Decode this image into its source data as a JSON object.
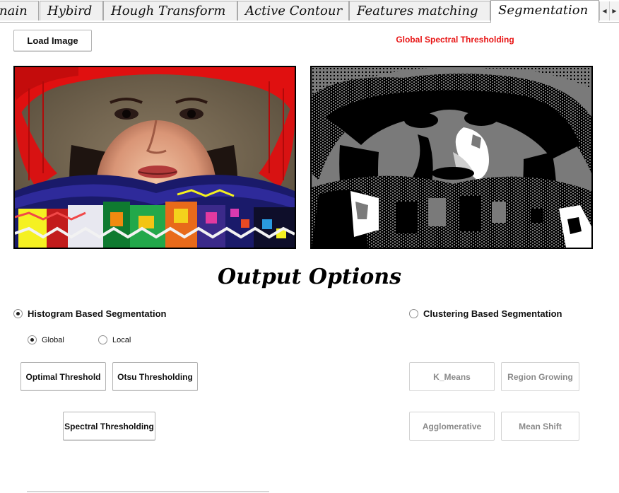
{
  "tabs": [
    {
      "label": "nain"
    },
    {
      "label": "Hybird"
    },
    {
      "label": "Hough Transform"
    },
    {
      "label": "Active Contour"
    },
    {
      "label": "Features matching"
    },
    {
      "label": "Segmentation"
    }
  ],
  "active_tab": "Segmentation",
  "tab_scroll": {
    "left_icon": "chevron-left-icon",
    "right_icon": "chevron-right-icon"
  },
  "toolbar": {
    "load_label": "Load Image"
  },
  "status": {
    "text": "Global Spectral Thresholding",
    "color": "#e81414"
  },
  "images": {
    "input": "input-photo",
    "output": "segmented-output"
  },
  "output_options": {
    "title": "Output Options"
  },
  "histogram": {
    "label": "Histogram Based Segmentation",
    "checked": true,
    "modes": [
      {
        "label": "Global",
        "checked": true
      },
      {
        "label": "Local",
        "checked": false
      }
    ],
    "buttons": [
      "Optimal Threshold",
      "Otsu Thresholding",
      "Spectral Thresholding"
    ]
  },
  "clustering": {
    "label": "Clustering Based Segmentation",
    "checked": false,
    "buttons": [
      "K_Means",
      "Region Growing",
      "Agglomerative",
      "Mean Shift"
    ]
  },
  "colors": {
    "status_red": "#e81414",
    "hat_red": "#e01010",
    "gray_level": "#7a7a7a"
  }
}
